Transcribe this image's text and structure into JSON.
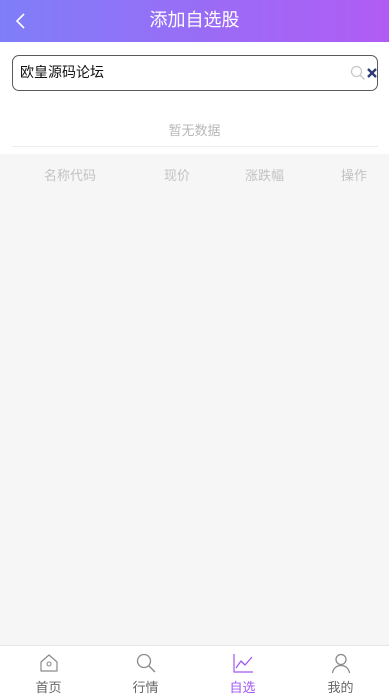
{
  "header": {
    "title": "添加自选股",
    "back_icon": "chevron-left-icon"
  },
  "search": {
    "value": "欧皇源码论坛",
    "search_icon": "search-icon",
    "clear_icon": "close-icon"
  },
  "result": {
    "empty_text": "暂无数据"
  },
  "table": {
    "columns": [
      "名称代码",
      "现价",
      "涨跌幅",
      "操作"
    ]
  },
  "tabbar": {
    "items": [
      {
        "label": "首页",
        "icon": "home-icon",
        "active": false
      },
      {
        "label": "行情",
        "icon": "search-icon",
        "active": false
      },
      {
        "label": "自选",
        "icon": "chart-line-icon",
        "active": true
      },
      {
        "label": "我的",
        "icon": "user-icon",
        "active": false
      }
    ]
  },
  "colors": {
    "header_gradient_start": "#7f7ef9",
    "header_gradient_end": "#b15cf4",
    "active_tab": "#a258f2",
    "background": "#f6f6f6"
  }
}
